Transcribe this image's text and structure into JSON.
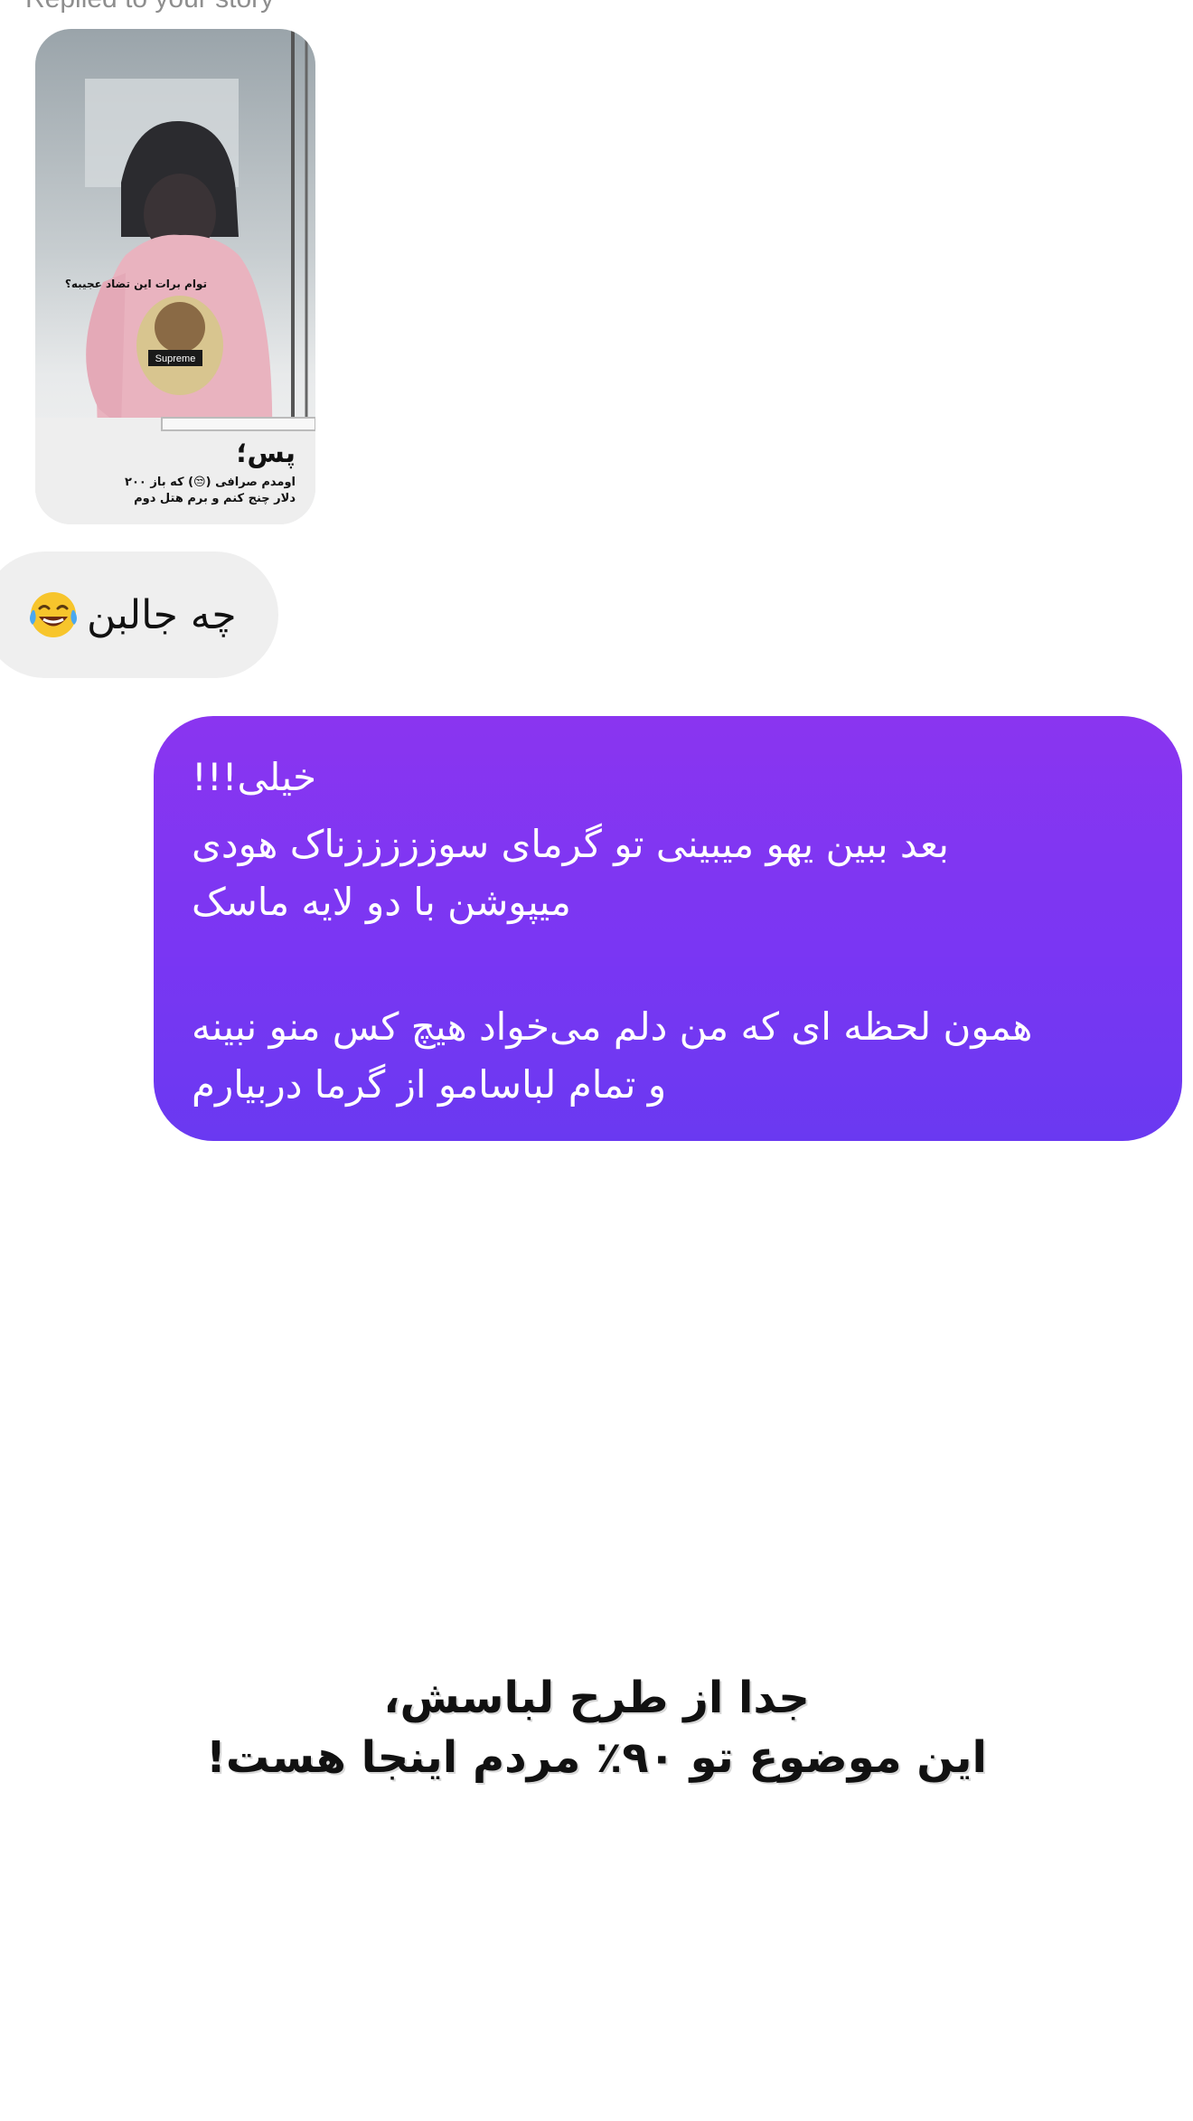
{
  "thread": {
    "replied_label": "Replied to your story",
    "story": {
      "overlay_text": "توام برات این تضاد عجیبه؟",
      "caption_title": "پس؛",
      "caption_line1": "اومدم صرافی (😒) که باز ۲۰۰",
      "caption_line2": "دلار چنج کنم و برم هتل دوم",
      "hoodie_brand": "Supreme"
    },
    "received_message": {
      "text": "چه جالبن",
      "emoji": "laughing-tears-emoji"
    },
    "sent_message": {
      "line1": "خیلی!!!",
      "line2": "بعد ببین یهو میبینی تو گرمای سوزززززناک هودی",
      "line3": "میپوشن با دو لایه ماسک",
      "line4": "همون لحظه ای که من دلم می‌خواد هیچ کس منو نبینه",
      "line5": "و تمام لباسامو از گرما دربیارم"
    }
  },
  "bottom_caption": {
    "line1": "جدا از طرح لباسش،",
    "line2": "این موضوع تو ۹۰٪ مردم اینجا هست!"
  },
  "colors": {
    "sent_bubble_top": "#8a35f0",
    "sent_bubble_bottom": "#6a39f1",
    "received_bubble": "#efefef",
    "meta_text": "#8e8e8e"
  }
}
